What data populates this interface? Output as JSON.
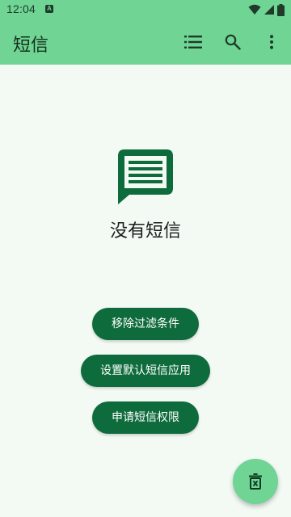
{
  "status_bar": {
    "time": "12:04",
    "notification_badge": "A",
    "icons": [
      "wifi-icon",
      "signal-icon",
      "battery-icon"
    ]
  },
  "app_bar": {
    "title": "短信",
    "actions": [
      "list-icon",
      "search-icon",
      "more-vert-icon"
    ]
  },
  "empty_state": {
    "icon": "message-icon",
    "title": "没有短信"
  },
  "buttons": {
    "remove_filters": "移除过滤条件",
    "set_default_sms": "设置默认短信应用",
    "request_sms_permission": "申请短信权限"
  },
  "fab": {
    "icon": "delete-box-icon"
  },
  "colors": {
    "app_bar": "#6fd494",
    "background": "#f3faf4",
    "primary_button": "#0e6b3c",
    "icon_dark": "#0e6b3c"
  }
}
